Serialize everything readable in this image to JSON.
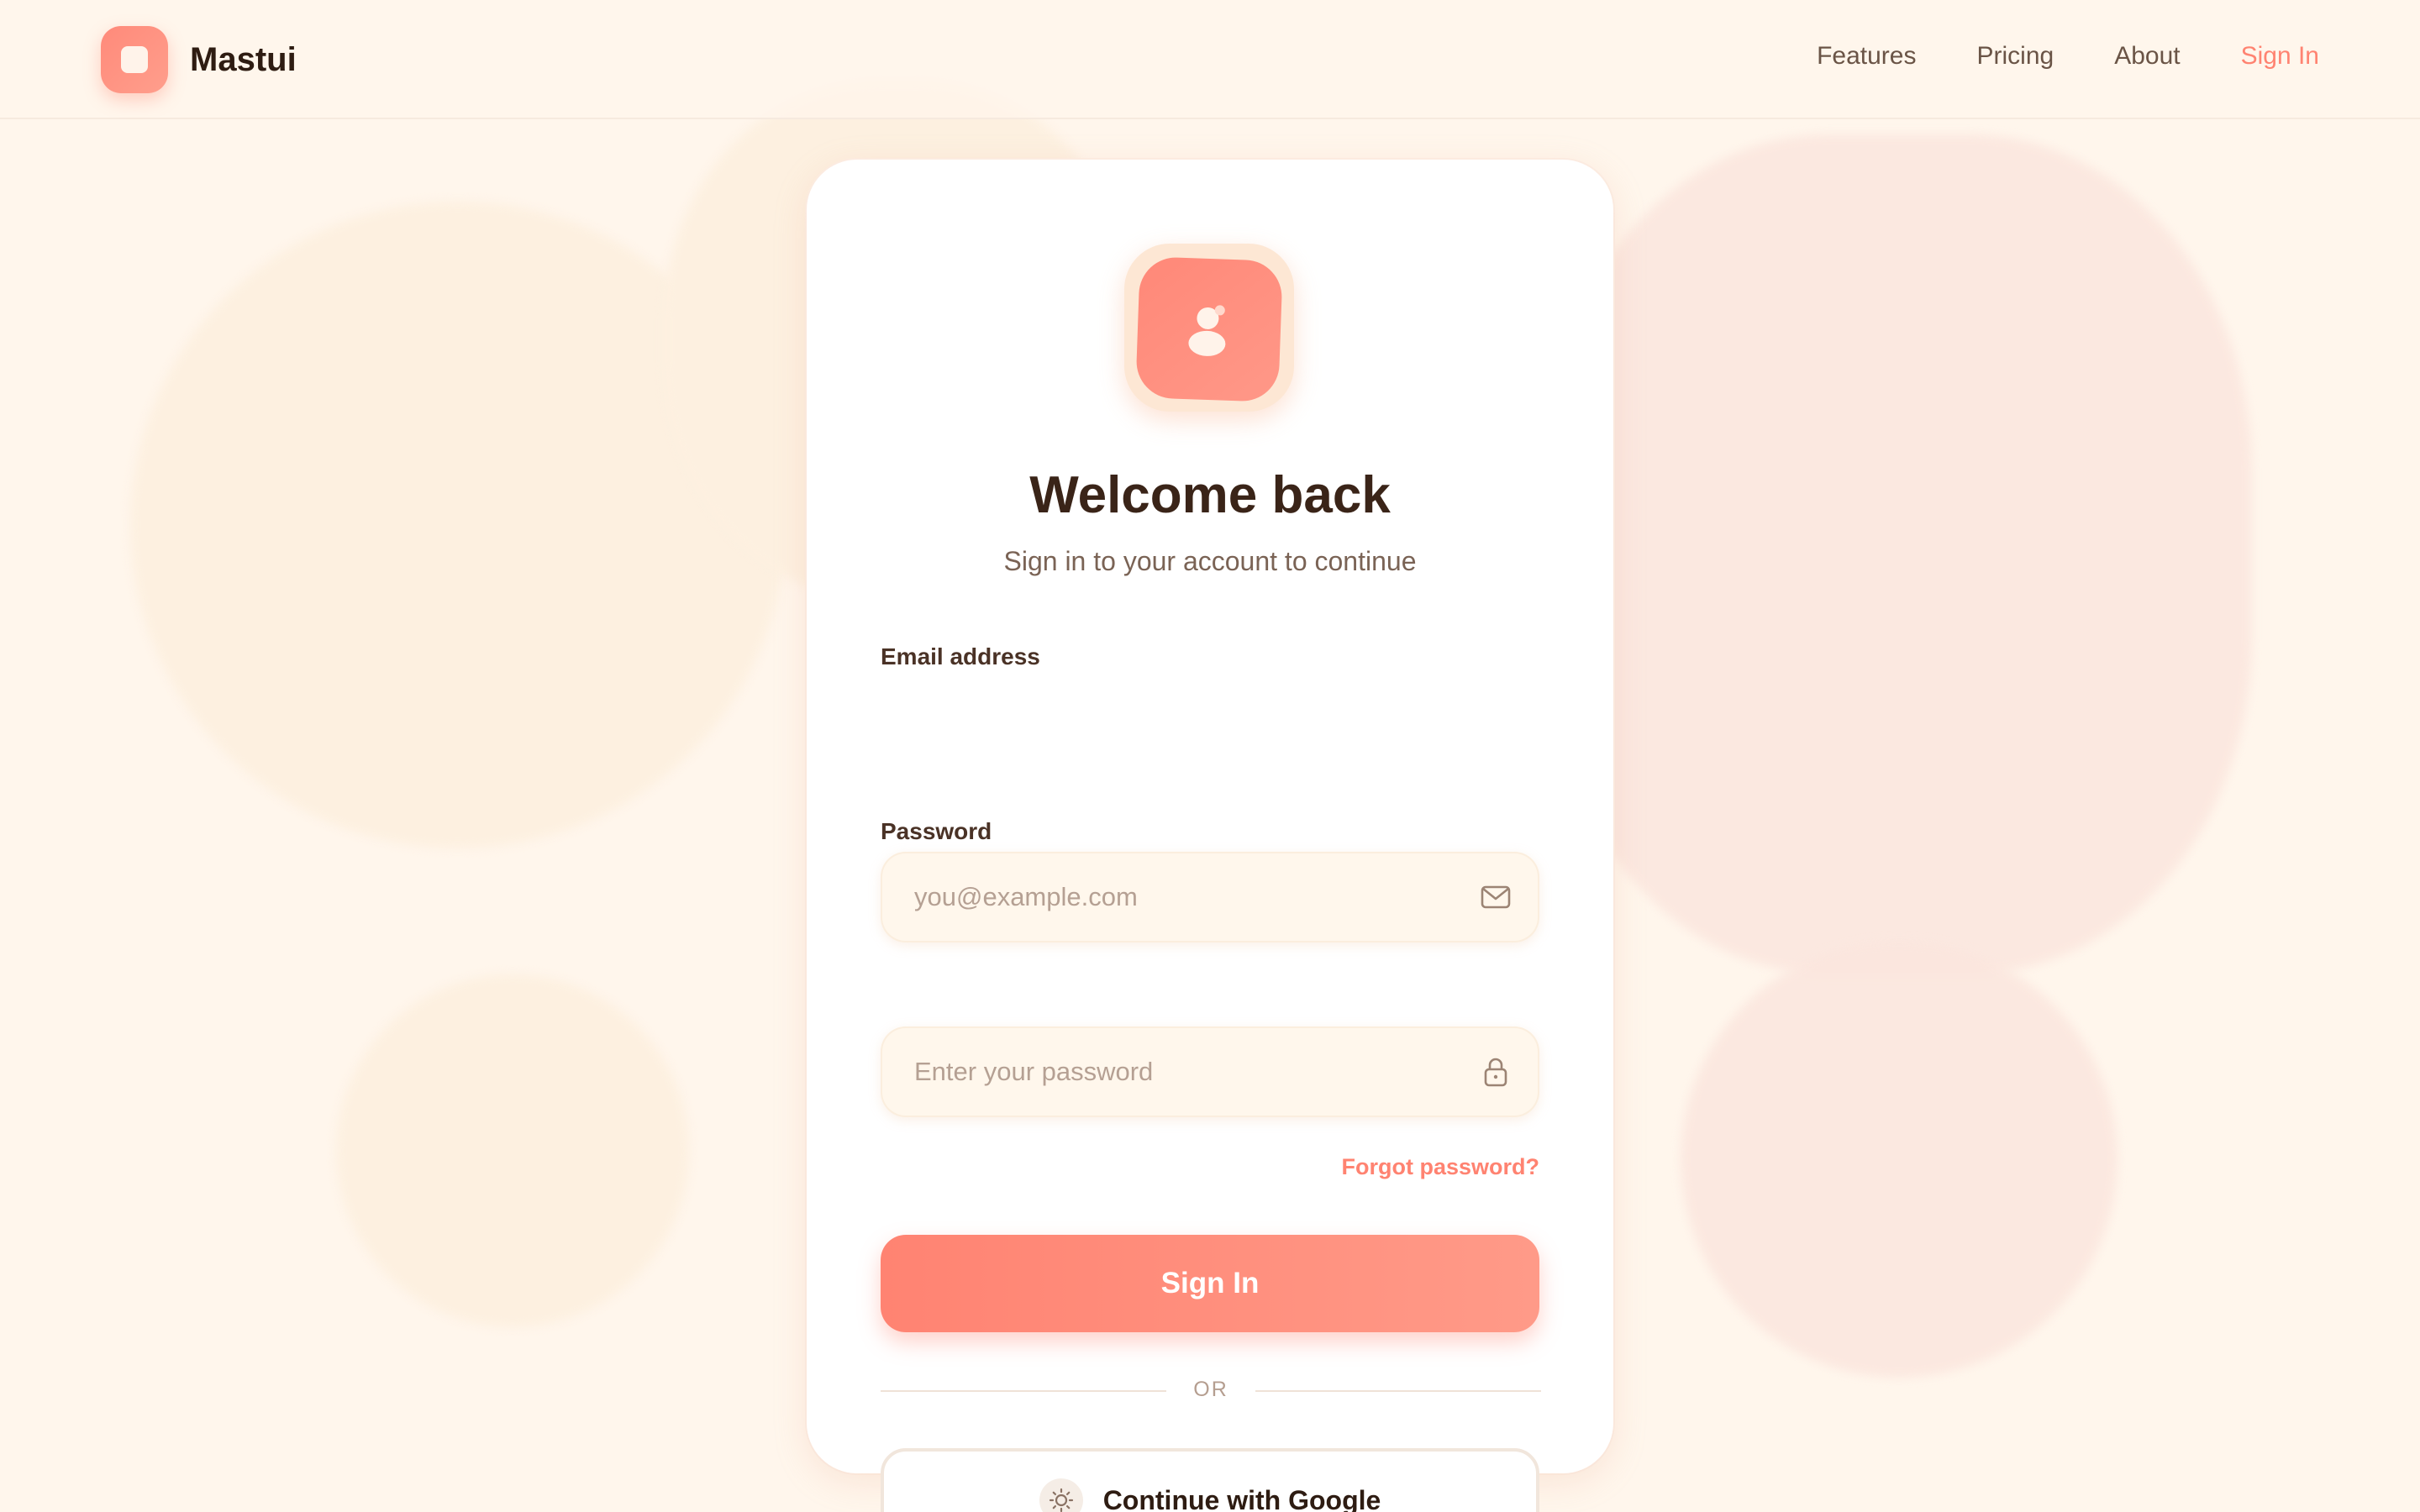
{
  "brand": {
    "name": "Mastui",
    "logo_icon": "app-logo-icon"
  },
  "nav": {
    "items": [
      {
        "label": "Features"
      },
      {
        "label": "Pricing"
      },
      {
        "label": "About"
      },
      {
        "label": "Sign In"
      }
    ]
  },
  "card": {
    "avatar_icon": "user-avatar-icon",
    "title": "Welcome back",
    "subtitle": "Sign in to your account to continue",
    "email": {
      "label": "Email address",
      "placeholder": "you@example.com",
      "value": "",
      "icon": "mail-icon"
    },
    "password": {
      "label": "Password",
      "placeholder": "Enter your password",
      "value": "",
      "icon": "lock-icon"
    },
    "forgot_label": "Forgot password?",
    "signin_label": "Sign In",
    "divider_label": "OR",
    "google_label": "Continue with Google",
    "google_icon": "google-icon"
  },
  "colors": {
    "accent": "#ff8371",
    "background": "#fff6ec",
    "card": "#ffffff",
    "text": "#3a2418"
  }
}
